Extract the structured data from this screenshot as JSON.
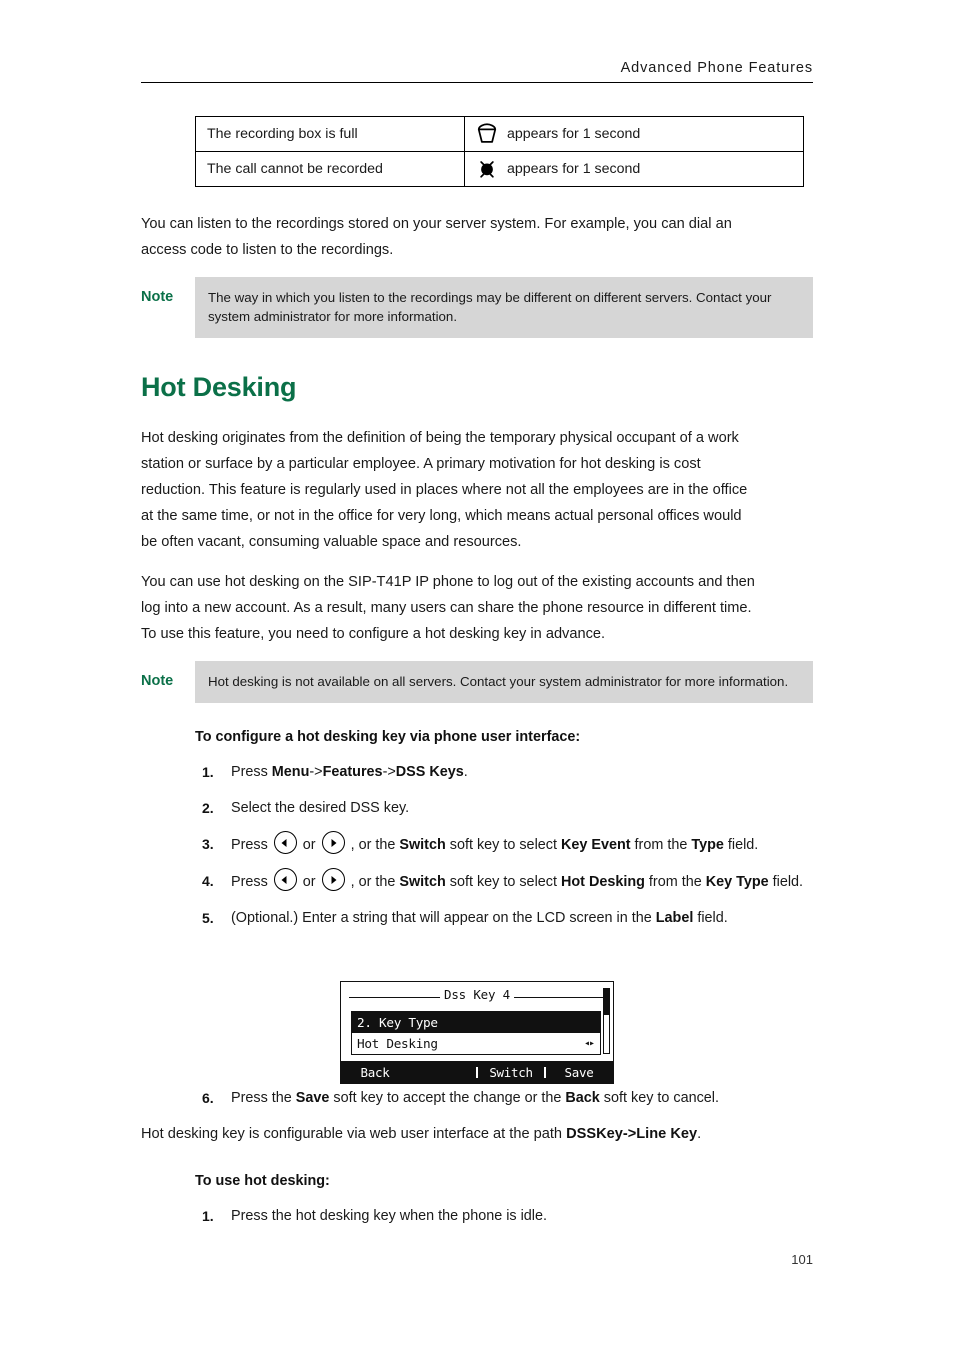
{
  "header": {
    "title": "Advanced Phone Features"
  },
  "icon_table": {
    "rows": [
      {
        "condition": "The recording box is full",
        "icon": "recording-box-full-icon",
        "action": "appears for 1 second"
      },
      {
        "condition": "The call cannot be recorded",
        "icon": "record-failed-icon",
        "action": "appears for 1 second"
      }
    ]
  },
  "intro_paragraph": "You can listen to the recordings stored on your server system. For example, you can dial an access code to listen to the recordings.",
  "note_1": {
    "label": "Note",
    "text": "The way in which you listen to the recordings may be different on different servers. Contact your system administrator for more information."
  },
  "section": {
    "heading": "Hot Desking",
    "paragraph_1": "Hot desking originates from the definition of being the temporary physical occupant of a work station or surface by a particular employee. A primary motivation for hot desking is cost reduction. This feature is regularly used in places where not all the employees are in the office at the same time, or not in the office for very long, which means actual personal offices would be often vacant, consuming valuable space and resources.",
    "paragraph_2": "You can use hot desking on the SIP-T41P IP phone to log out of the existing accounts and then log into a new account. As a result, many users can share the phone resource in different time. To use this feature, you need to configure a hot desking key in advance."
  },
  "note_2": {
    "label": "Note",
    "text": "Hot desking is not available on all servers. Contact your system administrator for more information."
  },
  "procedure_1": {
    "title": "To configure a hot desking key via phone user interface:",
    "steps": [
      {
        "num": "1.",
        "parts": [
          {
            "t": "Press ",
            "b": false
          },
          {
            "t": "Menu",
            "b": true
          },
          {
            "t": "->",
            "b": false
          },
          {
            "t": "Features",
            "b": true
          },
          {
            "t": "->",
            "b": false
          },
          {
            "t": "DSS Keys",
            "b": true
          },
          {
            "t": ".",
            "b": false
          }
        ]
      },
      {
        "num": "2.",
        "parts": [
          {
            "t": "Select the desired DSS key.",
            "b": false
          }
        ]
      },
      {
        "num": "3.",
        "parts": [
          {
            "t": "Press ",
            "b": false
          },
          {
            "icon": "nav-left-key-icon"
          },
          {
            "t": " or ",
            "b": false
          },
          {
            "icon": "nav-right-key-icon"
          },
          {
            "t": " , or the ",
            "b": false
          },
          {
            "t": "Switch",
            "b": true
          },
          {
            "t": " soft key to select ",
            "b": false
          },
          {
            "t": "Key Event",
            "b": true
          },
          {
            "t": " from the ",
            "b": false
          },
          {
            "t": "Type",
            "b": true
          },
          {
            "t": " field.",
            "b": false
          }
        ]
      },
      {
        "num": "4.",
        "parts": [
          {
            "t": "Press ",
            "b": false
          },
          {
            "icon": "nav-left-key-icon"
          },
          {
            "t": " or ",
            "b": false
          },
          {
            "icon": "nav-right-key-icon"
          },
          {
            "t": " , or the ",
            "b": false
          },
          {
            "t": "Switch",
            "b": true
          },
          {
            "t": " soft key to select ",
            "b": false
          },
          {
            "t": "Hot Desking",
            "b": true
          },
          {
            "t": " from the ",
            "b": false
          },
          {
            "t": "Key Type",
            "b": true
          },
          {
            "t": " field.",
            "b": false
          }
        ]
      },
      {
        "num": "5.",
        "parts": [
          {
            "t": "(Optional.) Enter a string that will appear on the LCD screen in the ",
            "b": false
          },
          {
            "t": "Label",
            "b": true
          },
          {
            "t": " field.",
            "b": false
          }
        ]
      },
      {
        "num": "6.",
        "parts": [
          {
            "t": "Press the ",
            "b": false
          },
          {
            "t": "Save",
            "b": true
          },
          {
            "t": " soft key to accept the change or the ",
            "b": false
          },
          {
            "t": "Back",
            "b": true
          },
          {
            "t": " soft key to cancel.",
            "b": false
          }
        ]
      }
    ]
  },
  "lcd": {
    "title": "Dss Key 4",
    "selected_item": "2. Key Type",
    "value_item": "Hot Desking",
    "value_arrows": "◂▸",
    "softkeys": [
      "Back",
      "",
      "Switch",
      "Save"
    ]
  },
  "web_ui_note": {
    "parts": [
      {
        "t": "Hot desking key is configurable via web user interface at the path ",
        "b": false
      },
      {
        "t": "DSSKey",
        "b": true
      },
      {
        "t": "->",
        "b": true
      },
      {
        "t": "Line Key",
        "b": true
      },
      {
        "t": ".",
        "b": false
      }
    ]
  },
  "procedure_2": {
    "title": "To use hot desking:",
    "steps": [
      {
        "num": "1.",
        "parts": [
          {
            "t": "Press the hot desking key when the phone is idle.",
            "b": false
          }
        ]
      }
    ]
  },
  "footer": {
    "page_number": "101"
  },
  "colors": {
    "accent_green": "#0b7048",
    "note_bg": "#d6d6d6",
    "text": "#1a1a1a"
  }
}
